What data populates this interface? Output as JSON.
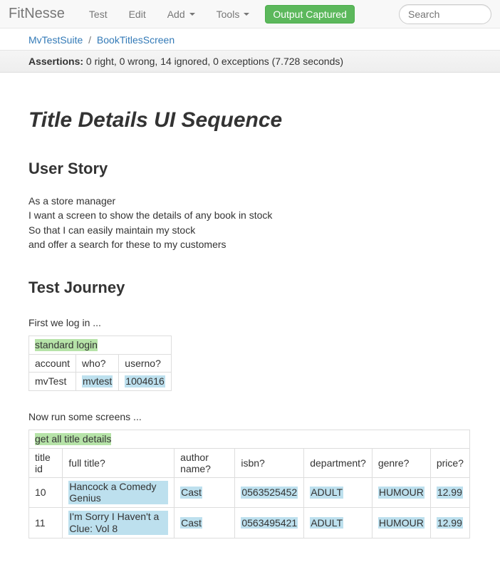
{
  "navbar": {
    "brand": "FitNesse",
    "items": [
      {
        "label": "Test",
        "dropdown": false
      },
      {
        "label": "Edit",
        "dropdown": false
      },
      {
        "label": "Add",
        "dropdown": true
      },
      {
        "label": "Tools",
        "dropdown": true
      }
    ],
    "output_button": "Output Captured",
    "search_placeholder": "Search"
  },
  "breadcrumbs": {
    "parent": "MvTestSuite",
    "current": "BookTitlesScreen"
  },
  "assertions": {
    "label": "Assertions:",
    "text": "0 right, 0 wrong, 14 ignored, 0 exceptions (7.728 seconds)"
  },
  "page_title": "Title Details UI Sequence",
  "sections": {
    "user_story": {
      "heading": "User Story",
      "lines": [
        "As a store manager",
        "I want a screen to show the details of any book in stock",
        "So that I can easily maintain my stock",
        "and offer a search for these to my customers"
      ]
    },
    "test_journey": {
      "heading": "Test Journey",
      "intro1": "First we log in ...",
      "login_table": {
        "fixture": "standard login",
        "headers": [
          "account",
          "who?",
          "userno?"
        ],
        "row": {
          "account": "mvTest",
          "who": "mvtest",
          "userno": "1004616"
        }
      },
      "intro2": "Now run some screens ...",
      "titles_table": {
        "fixture": "get all title details",
        "headers": [
          "title id",
          "full title?",
          "author name?",
          "isbn?",
          "department?",
          "genre?",
          "price?"
        ],
        "rows": [
          {
            "id": "10",
            "title": "Hancock a Comedy Genius",
            "author": "Cast",
            "isbn": "0563525452",
            "dept": "ADULT",
            "genre": "HUMOUR",
            "price": "12.99"
          },
          {
            "id": "11",
            "title": "I'm Sorry I Haven't a Clue: Vol 8",
            "author": "Cast",
            "isbn": "0563495421",
            "dept": "ADULT",
            "genre": "HUMOUR",
            "price": "12.99"
          }
        ]
      }
    }
  }
}
